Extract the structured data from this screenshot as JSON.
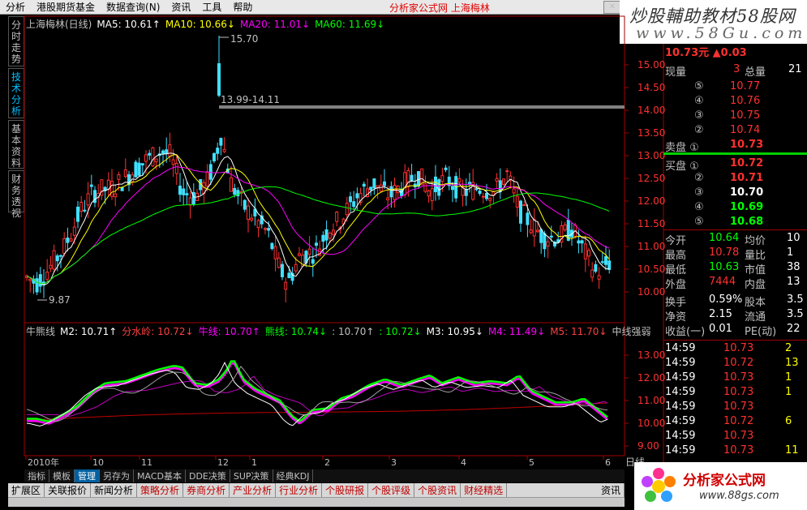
{
  "menu": {
    "items": [
      "分析",
      "港股期货基金",
      "数据查询(N)",
      "资讯",
      "工具",
      "帮助"
    ],
    "center": "分析家公式网 上海梅林",
    "ctrl": "✕"
  },
  "brand": {
    "line1": "炒股輔助教材58股网",
    "line2": "www.58Gu.com"
  },
  "left_tabs": [
    "分时走势",
    "技术分析",
    "基本资料",
    "财务透视"
  ],
  "header1": [
    {
      "t": "上海梅林(日线)",
      "c": "#c0c0c0"
    },
    {
      "t": "MA5: 10.61↑",
      "c": "#ffffff"
    },
    {
      "t": "MA10: 10.66↓",
      "c": "#ffff00"
    },
    {
      "t": "MA20: 11.01↓",
      "c": "#ff00ff"
    },
    {
      "t": "MA60: 11.69↓",
      "c": "#00ff00"
    }
  ],
  "header2": [
    {
      "t": "牛熊线",
      "c": "#c0c0c0"
    },
    {
      "t": "M2: 10.71↑",
      "c": "#ffffff"
    },
    {
      "t": "分水岭: 10.72↓",
      "c": "#ff4040"
    },
    {
      "t": "牛线: 10.70↑",
      "c": "#ff00ff"
    },
    {
      "t": "熊线: 10.74↓",
      "c": "#00ff00"
    },
    {
      "t": ": 10.70↑",
      "c": "#c0c0c0"
    },
    {
      "t": ": 10.72↓",
      "c": "#00ff00"
    },
    {
      "t": "M3: 10.95↓",
      "c": "#ffffff"
    },
    {
      "t": "M4: 11.49↓",
      "c": "#ff00ff"
    },
    {
      "t": "M5: 11.70↓",
      "c": "#ff4040"
    },
    {
      "t": "中线强弱",
      "c": "#c0c0c0"
    }
  ],
  "price_axis": [
    "15.00",
    "14.50",
    "14.00",
    "13.50",
    "13.00",
    "12.50",
    "12.00",
    "11.50",
    "11.00",
    "10.50",
    "10.00"
  ],
  "ind_axis": [
    "13.00",
    "12.00",
    "11.00",
    "10.00",
    "9.00"
  ],
  "annotations": {
    "high": "15.70",
    "range": "13.99-14.11",
    "low": "9.87"
  },
  "date_axis": [
    "2010年",
    "10",
    "11",
    "12",
    "1",
    "2",
    "3",
    "4",
    "5",
    "6"
  ],
  "day_btn": "日线",
  "right_panel": {
    "top": "10.73元  ▲0.03",
    "xianliang": "现量",
    "xl_val": "3",
    "zongliang": "总量",
    "zl_val": "21",
    "asks": [
      {
        "n": "⑤",
        "p": "10.77"
      },
      {
        "n": "④",
        "p": "10.76"
      },
      {
        "n": "③",
        "p": "10.75"
      },
      {
        "n": "②",
        "p": "10.74"
      },
      {
        "n": "卖盘 ①",
        "p": "10.73"
      }
    ],
    "bids": [
      {
        "n": "买盘 ①",
        "p": "10.72",
        "c": "#ff3030"
      },
      {
        "n": "②",
        "p": "10.71",
        "c": "#ff3030"
      },
      {
        "n": "③",
        "p": "10.70",
        "c": "#ffffff"
      },
      {
        "n": "④",
        "p": "10.69",
        "c": "#00ff00"
      },
      {
        "n": "⑤",
        "p": "10.68",
        "c": "#00ff00"
      }
    ],
    "stats": [
      {
        "a": "今开",
        "av": "10.64",
        "ac": "#00ff00",
        "b": "均价",
        "bv": "10"
      },
      {
        "a": "最高",
        "av": "10.78",
        "ac": "#ff3030",
        "b": "量比",
        "bv": "1"
      },
      {
        "a": "最低",
        "av": "10.63",
        "ac": "#00ff00",
        "b": "市值",
        "bv": "38"
      },
      {
        "a": "外盘",
        "av": "7444",
        "ac": "#ff3030",
        "b": "内盘",
        "bv": "13"
      },
      {
        "a": "换手",
        "av": "0.59%",
        "ac": "#ffffff",
        "b": "股本",
        "bv": "3.5"
      },
      {
        "a": "净资",
        "av": "2.15",
        "ac": "#ffffff",
        "b": "流通",
        "bv": "3.5"
      },
      {
        "a": "收益(一)",
        "av": "0.01",
        "ac": "#ffffff",
        "b": "PE(动)",
        "bv": "22"
      }
    ],
    "ticks": [
      {
        "t": "14:59",
        "p": "10.73",
        "c": "#ff3030",
        "v": "2"
      },
      {
        "t": "14:59",
        "p": "10.72",
        "c": "#ff3030",
        "v": "13"
      },
      {
        "t": "14:59",
        "p": "10.73",
        "c": "#ff3030",
        "v": "1"
      },
      {
        "t": "14:59",
        "p": "10.73",
        "c": "#ff3030",
        "v": "1"
      },
      {
        "t": "14:59",
        "p": "10.73",
        "c": "#ff3030",
        "v": ""
      },
      {
        "t": "14:59",
        "p": "10.72",
        "c": "#ff3030",
        "v": "6"
      },
      {
        "t": "14:59",
        "p": "10.73",
        "c": "#ff3030",
        "v": ""
      },
      {
        "t": "14:59",
        "p": "10.73",
        "c": "#ff3030",
        "v": "11"
      }
    ]
  },
  "bottom_tabs": [
    "指标",
    "模板",
    "管理",
    "另存为",
    "MACD基本",
    "DDE决策",
    "SUP决策",
    "经典KDJ"
  ],
  "bottom_nav": [
    "扩展区",
    "关联报价",
    "新闻分析",
    "策略分析",
    "券商分析",
    "产业分析",
    "行业分析",
    "个股研报",
    "个股评级",
    "个股资讯",
    "财经精选"
  ],
  "bottom_right": "资讯",
  "logo": {
    "l1": "分析家公式网",
    "l2": "www.88gs.com"
  }
}
